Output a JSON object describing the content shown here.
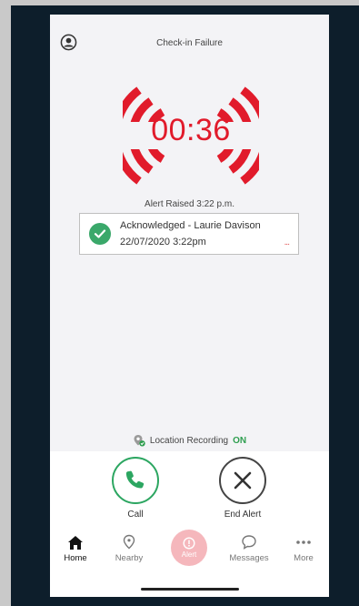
{
  "header": {
    "title": "Check-in Failure",
    "profile_icon": "profile-circle-icon"
  },
  "timer": {
    "value": "00:36",
    "color": "#e11b2b"
  },
  "alert": {
    "raised_text": "Alert Raised 3:22 p.m."
  },
  "acknowledgement": {
    "name": "Acknowledged - Laurie Davison",
    "time": "22/07/2020 3:22pm",
    "more": "...",
    "icon": "check-circle-icon",
    "color": "#3aa86a"
  },
  "location": {
    "label": "Location Recording",
    "status": "ON",
    "status_color": "#2e9e4f"
  },
  "actions": {
    "call_label": "Call",
    "end_label": "End Alert"
  },
  "tabs": [
    {
      "label": "Home",
      "icon": "home-icon",
      "active": true
    },
    {
      "label": "Nearby",
      "icon": "nearby-pin-icon"
    },
    {
      "label": "Alert",
      "icon": "alert-icon"
    },
    {
      "label": "Messages",
      "icon": "message-bubble-icon"
    },
    {
      "label": "More",
      "icon": "more-dots-icon"
    }
  ]
}
